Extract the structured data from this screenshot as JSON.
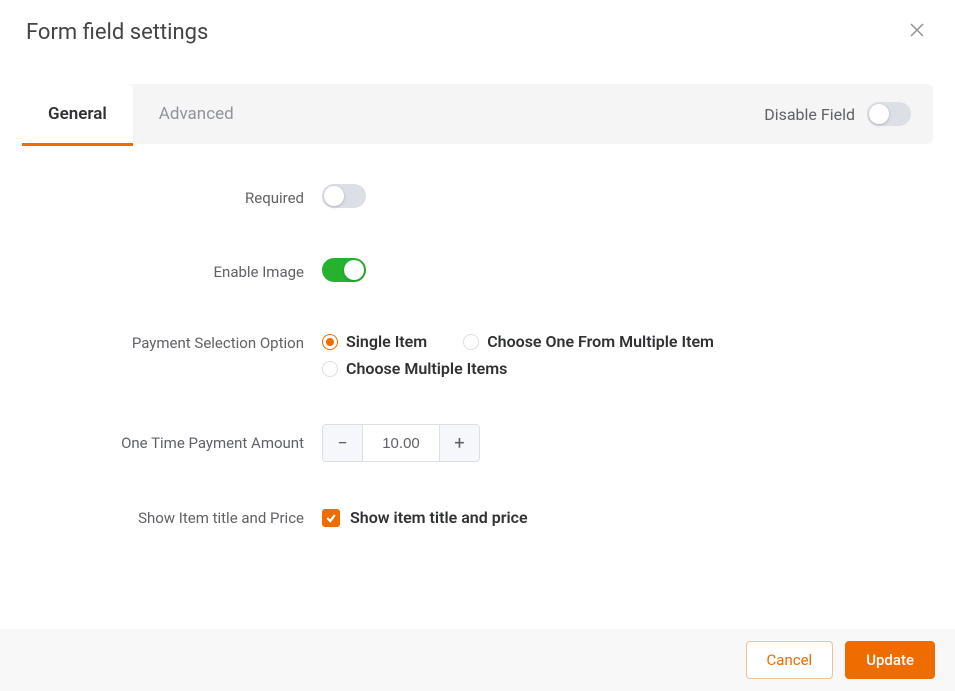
{
  "header": {
    "title": "Form field settings"
  },
  "tabs": {
    "general": "General",
    "advanced": "Advanced",
    "disable_label": "Disable Field"
  },
  "fields": {
    "required": {
      "label": "Required",
      "on": false
    },
    "enable_image": {
      "label": "Enable Image",
      "on": true
    },
    "payment_selection": {
      "label": "Payment Selection Option",
      "options": {
        "single": "Single Item",
        "choose_one": "Choose One From Multiple Item",
        "choose_multiple": "Choose Multiple Items"
      },
      "selected": "single"
    },
    "one_time_amount": {
      "label": "One Time Payment Amount",
      "value": "10.00"
    },
    "show_item_title_price": {
      "label": "Show Item title and Price",
      "checkbox_label": "Show item title and price",
      "checked": true
    }
  },
  "footer": {
    "cancel": "Cancel",
    "update": "Update"
  },
  "colors": {
    "accent": "#ef6c00",
    "switch_on": "#26b22f"
  }
}
